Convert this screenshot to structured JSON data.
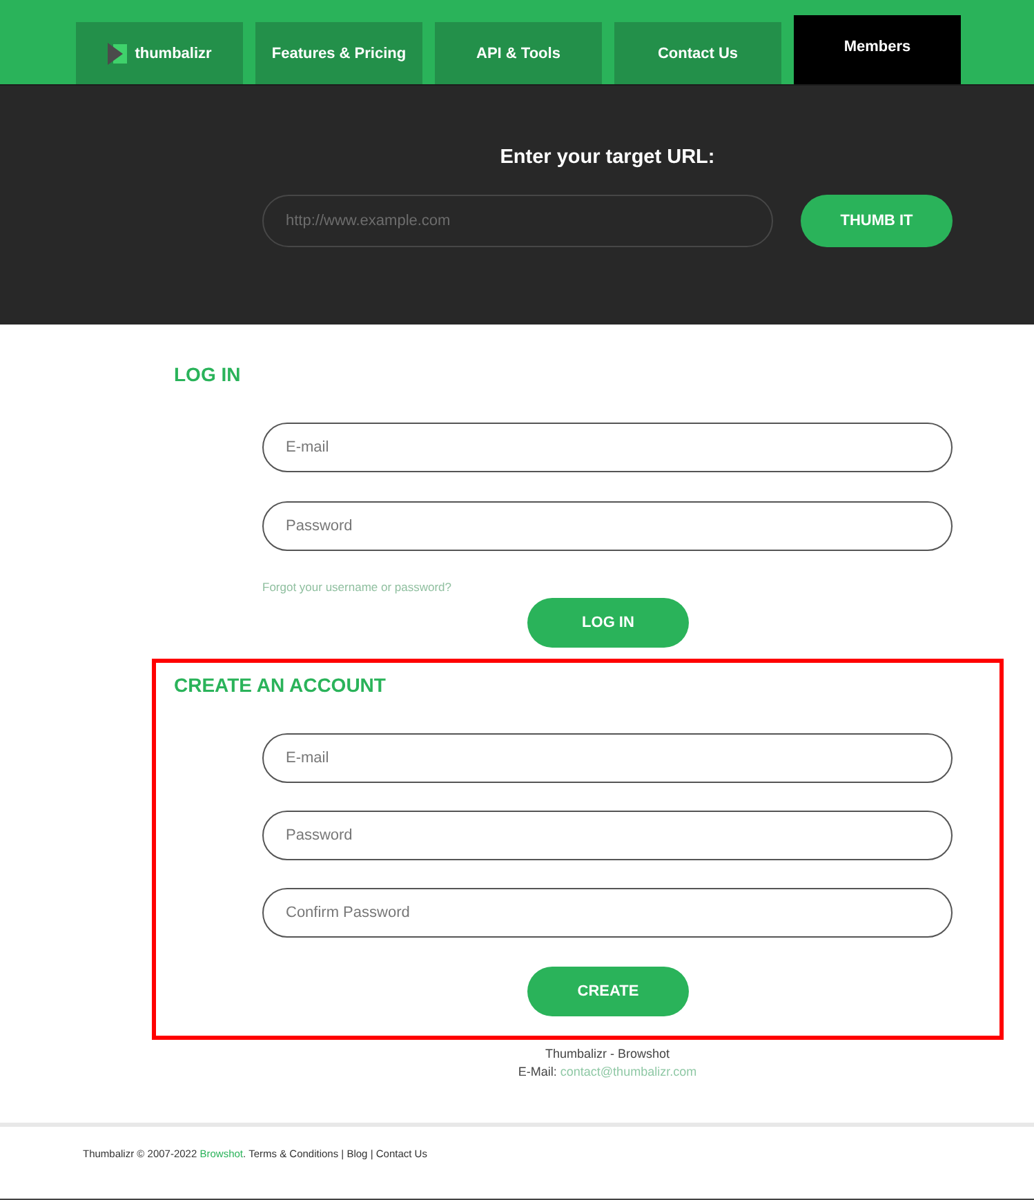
{
  "nav": {
    "tabs": [
      {
        "label": "thumbalizr",
        "kind": "logo",
        "selected": false
      },
      {
        "label": "Features & Pricing",
        "kind": "link",
        "selected": false
      },
      {
        "label": "API & Tools",
        "kind": "link",
        "selected": false
      },
      {
        "label": "Contact Us",
        "kind": "link",
        "selected": false
      },
      {
        "label": "Members",
        "kind": "link",
        "selected": true
      }
    ]
  },
  "hero": {
    "title": "Enter your target URL:",
    "url_field": {
      "placeholder": "http://www.example.com"
    },
    "button": "THUMB IT"
  },
  "login": {
    "heading": "LOG IN",
    "fields": [
      {
        "placeholder": "E-mail"
      },
      {
        "placeholder": "Password"
      }
    ],
    "forgot_link": "Forgot your username or password?",
    "button": "LOG IN"
  },
  "create_account": {
    "highlighted": true,
    "heading": "CREATE AN ACCOUNT",
    "fields": [
      {
        "placeholder": "E-mail"
      },
      {
        "placeholder": "Password"
      },
      {
        "placeholder": "Confirm Password"
      }
    ],
    "button": "CREATE"
  },
  "contact": {
    "company": "Thumbalizr - Browshot",
    "email_label": "E-Mail:",
    "email": "contact@thumbalizr.com"
  },
  "footer": {
    "parts": [
      {
        "kind": "text",
        "text": "Thumbalizr © 2007-2022 "
      },
      {
        "kind": "brand_link",
        "text": "Browshot"
      },
      {
        "kind": "text",
        "text": ". "
      },
      {
        "kind": "link",
        "text": "Terms & Conditions"
      },
      {
        "kind": "text",
        "text": " | "
      },
      {
        "kind": "link",
        "text": "Blog"
      },
      {
        "kind": "text",
        "text": " | "
      },
      {
        "kind": "link",
        "text": "Contact Us"
      }
    ]
  }
}
